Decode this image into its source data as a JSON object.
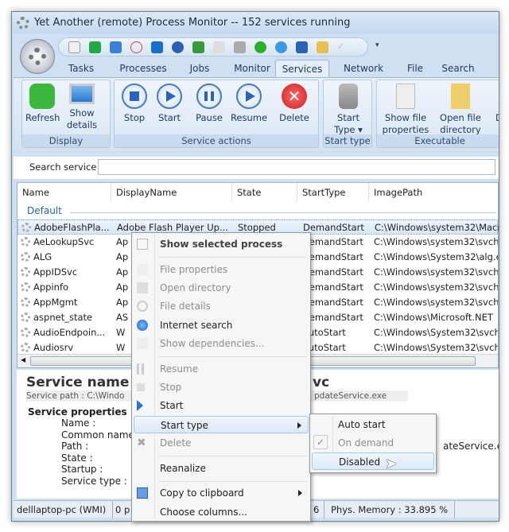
{
  "window": {
    "title": "Yet Another (remote) Process Monitor -- 152 services running"
  },
  "tabs": [
    {
      "label": "Tasks"
    },
    {
      "label": "Processes"
    },
    {
      "label": "Jobs"
    },
    {
      "label": "Monitor"
    },
    {
      "label": "Services",
      "active": true
    },
    {
      "label": "Network"
    },
    {
      "label": "File"
    },
    {
      "label": "Search"
    }
  ],
  "ribbon": {
    "display": {
      "label": "Display",
      "refresh": "Refresh",
      "show_details": "Show details"
    },
    "service_actions": {
      "label": "Service actions",
      "stop": "Stop",
      "start": "Start",
      "pause": "Pause",
      "resume": "Resume",
      "delete": "Delete"
    },
    "start_type": {
      "label": "Start type",
      "button": "Start Type"
    },
    "executable": {
      "label": "Executable",
      "show_file_properties": "Show file properties",
      "open_file_directory": "Open file directory",
      "partial": "De"
    }
  },
  "search": {
    "label": "Search service",
    "value": ""
  },
  "table": {
    "columns": [
      "Name",
      "DisplayName",
      "State",
      "StartType",
      "ImagePath"
    ],
    "group": "Default",
    "rows": [
      {
        "name": "AdobeFlashPla...",
        "display": "Adobe Flash Player Up...",
        "state": "Stopped",
        "starttype": "DemandStart",
        "path": "C:\\Windows\\system32\\Macr",
        "selected": true
      },
      {
        "name": "AeLookupSvc",
        "display": "Ap",
        "state": "",
        "starttype": "DemandStart",
        "path": "C:\\Windows\\system32\\svch"
      },
      {
        "name": "ALG",
        "display": "Ap",
        "state": "",
        "starttype": "DemandStart",
        "path": "C:\\Windows\\System32\\alg.e"
      },
      {
        "name": "AppIDSvc",
        "display": "Ap",
        "state": "",
        "starttype": "DemandStart",
        "path": "C:\\Windows\\system32\\svch"
      },
      {
        "name": "Appinfo",
        "display": "Ap",
        "state": "",
        "starttype": "DemandStart",
        "path": "C:\\Windows\\system32\\svch"
      },
      {
        "name": "AppMgmt",
        "display": "Ap",
        "state": "",
        "starttype": "DemandStart",
        "path": "C:\\Windows\\system32\\svch"
      },
      {
        "name": "aspnet_state",
        "display": "AS",
        "state": "",
        "starttype": "DemandStart",
        "path": "C:\\Windows\\Microsoft.NET"
      },
      {
        "name": "AudioEndpoin...",
        "display": "W",
        "state": "",
        "starttype": "AutoStart",
        "path": "C:\\Windows\\System32\\svch"
      },
      {
        "name": "Audiosrv",
        "display": "W",
        "state": "",
        "starttype": "AutoStart",
        "path": "C:\\Windows\\System32\\svch"
      }
    ]
  },
  "details": {
    "service_name_label": "Service name :",
    "service_name_tail": "vc",
    "service_path": "Service path : C:\\Windo",
    "service_path_tail": "pdateService.exe",
    "properties_title": "Service properties",
    "props": [
      "Name :",
      "Common name",
      "Path :",
      "State :",
      "Startup :",
      "Service type :"
    ],
    "path_value_tail": "ateService.ex"
  },
  "status": {
    "machine": "delllaptop-pc (WMI)",
    "processes": "0 p",
    "mid": "6",
    "memory": "Phys. Memory : 33.895 %"
  },
  "context_menu": {
    "items": {
      "show_selected": "Show selected process",
      "file_properties": "File properties",
      "open_directory": "Open directory",
      "file_details": "File details",
      "internet_search": "Internet search",
      "show_dependencies": "Show dependencies...",
      "resume": "Resume",
      "stop": "Stop",
      "start": "Start",
      "start_type": "Start type",
      "delete": "Delete",
      "reanalize": "Reanalize",
      "copy": "Copy to clipboard",
      "choose_columns": "Choose columns..."
    }
  },
  "submenu": {
    "auto_start": "Auto start",
    "on_demand": "On demand",
    "disabled": "Disabled",
    "checked": "On demand",
    "hovered": "Disabled"
  },
  "colors": {
    "accent": "#3a78c4",
    "ribbon_bg": "#dbe7f5",
    "highlight": "#dbe9f8"
  }
}
